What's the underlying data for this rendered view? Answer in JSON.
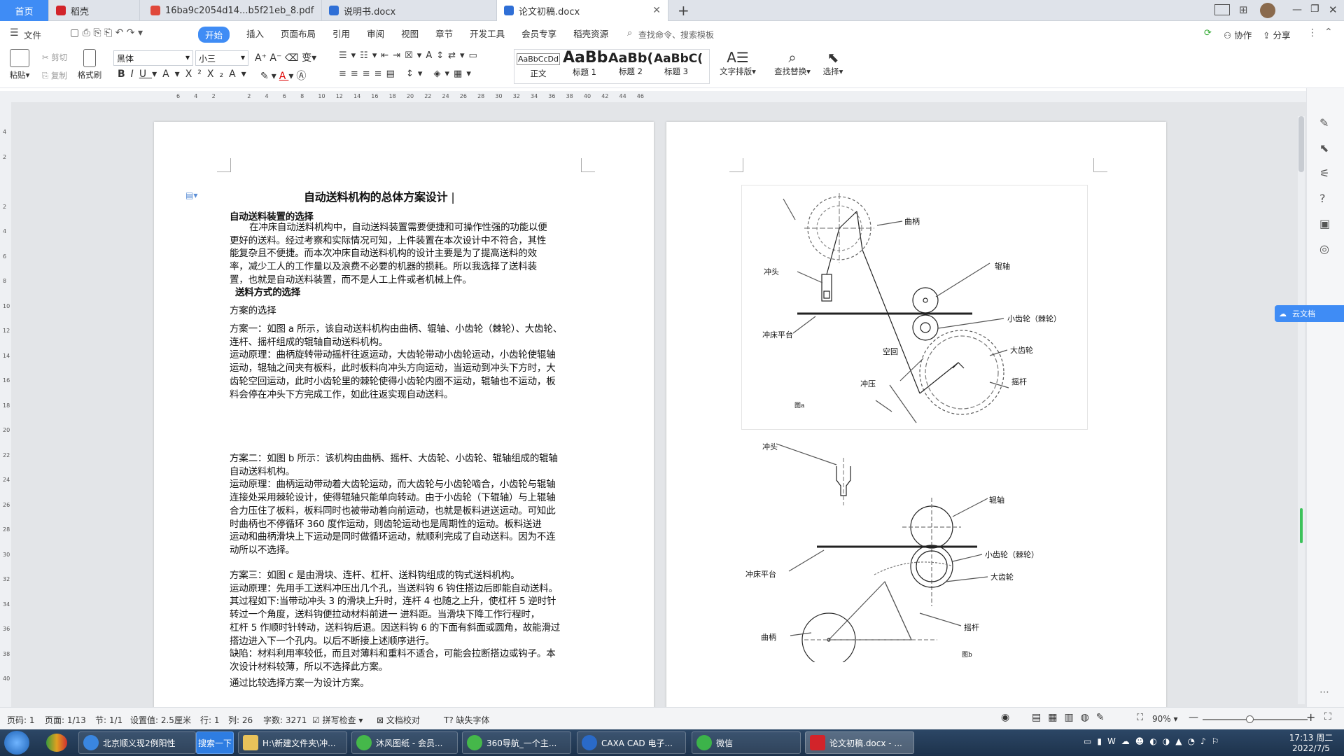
{
  "tabs": [
    {
      "label": "首页",
      "active": false
    },
    {
      "label": "稻壳",
      "active": false
    },
    {
      "label": "16ba9c2054d14...b5f21eb_8.pdf",
      "active": false
    },
    {
      "label": "说明书.docx",
      "active": false
    },
    {
      "label": "论文初稿.docx",
      "active": true
    }
  ],
  "menubar": {
    "file": "文件",
    "items": [
      "开始",
      "插入",
      "页面布局",
      "引用",
      "审阅",
      "视图",
      "章节",
      "开发工具",
      "会员专享",
      "稻壳资源"
    ],
    "active": "开始",
    "search": "查找命令、搜索模板",
    "collab": "协作",
    "share": "分享"
  },
  "ribbon": {
    "paste": "粘贴",
    "cut": "剪切",
    "copy": "复制",
    "format_painter": "格式刷",
    "font_name": "黑体",
    "font_size": "小三",
    "styles": [
      {
        "preview": "AaBbCcDd",
        "name": "正文"
      },
      {
        "preview": "AaBb",
        "name": "标题 1"
      },
      {
        "preview": "AaBb(",
        "name": "标题 2"
      },
      {
        "preview": "AaBbC(",
        "name": "标题 3"
      }
    ],
    "text_layout": "文字排版",
    "find_replace": "查找替换",
    "select": "选择"
  },
  "ruler": {
    "h_ticks": [
      "6",
      "4",
      "2",
      "",
      "2",
      "4",
      "6",
      "8",
      "10",
      "12",
      "14",
      "16",
      "18",
      "20",
      "22",
      "24",
      "26",
      "28",
      "30",
      "32",
      "34",
      "36",
      "38",
      "40",
      "42",
      "44",
      "46"
    ],
    "v_ticks": [
      "4",
      "2",
      "",
      "2",
      "4",
      "6",
      "8",
      "10",
      "12",
      "14",
      "16",
      "18",
      "20",
      "22",
      "24",
      "26",
      "28",
      "30",
      "32",
      "34",
      "36",
      "38",
      "40"
    ]
  },
  "document": {
    "title": "自动送料机构的总体方案设计",
    "h1": "自动送料装置的选择",
    "para1": [
      "在冲床自动送料机构中，自动送料装置需要便捷和可操作性强的功能以便",
      "更好的送料。经过考察和实际情况可知，上件装置在本次设计中不符合，其性",
      "能复杂且不便捷。而本次冲床自动送料机构的设计主要是为了提高送料的效",
      "率，减少工人的工作量以及浪费不必要的机器的损耗。所以我选择了送料装",
      "置，也就是自动送料装置，而不是人工上件或者机械上件。"
    ],
    "h2": "送料方式的选择",
    "h3": "方案的选择",
    "scheme1": [
      "方案一：如图 a 所示，该自动送料机构由曲柄、辊轴、小齿轮（棘轮）、大齿轮、",
      "连杆、摇杆组成的辊轴自动送料机构。",
      "运动原理：曲柄旋转带动摇杆往返运动，大齿轮带动小齿轮运动，小齿轮使辊轴",
      "运动，辊轴之间夹有板料，此时板料向冲头方向运动，当运动到冲头下方时，大",
      "齿轮空回运动，此时小齿轮里的棘轮使得小齿轮内圈不运动，辊轴也不运动，板",
      "料会停在冲头下方完成工作，如此往返实现自动送料。"
    ],
    "scheme2": [
      "方案二：如图 b 所示：该机构由曲柄、摇杆、大齿轮、小齿轮、辊轴组成的辊轴",
      "自动送料机构。",
      "运动原理：曲柄运动带动着大齿轮运动，而大齿轮与小齿轮啮合，小齿轮与辊轴",
      "连接处采用棘轮设计，使得辊轴只能单向转动。由于小齿轮（下辊轴）与上辊轴",
      "合力压住了板料，板料同时也被带动着向前运动，也就是板料进送运动。可知此",
      "时曲柄也不停循环    360    度作运动，则齿轮运动也是周期性的运动。板料送进",
      "运动和曲柄滑块上下运动是同时做循环运动，就顺利完成了自动送料。因为不连",
      "动所以不选择。"
    ],
    "scheme3": [
      "方案三：如图 c 是由滑块、连杆、杠杆、送料钩组成的钩式送料机构。",
      "运动原理：先用手工送料冲压出几个孔，当送料钩 6 钩住搭边后即能自动送料。",
      "其过程如下:当带动冲头 3 的滑块上升时，连杆 4 也随之上升，使杠杆 5 逆时针",
      "转过一个角度，送料钩便拉动材料前进一    进料距。当滑块下降工作行程时，",
      "杠杆 5 作顺时针转动，送料钩后退。因送料钩 6 的下面有斜面或圆角，故能滑过",
      "搭边进入下一个孔内。以后不断接上述顺序进行。",
      "缺陷：材料利用率较低，而且对薄料和重料不适合，可能会拉断搭边或钩子。本",
      "次设计材料较薄，所以不选择此方案。"
    ],
    "conclusion": "通过比较选择方案一为设计方案。"
  },
  "figure_a": {
    "labels": [
      "曲柄",
      "冲头",
      "辊轴",
      "小齿轮（棘轮）",
      "冲床平台",
      "大齿轮",
      "空回",
      "冲压",
      "摇杆"
    ],
    "caption": "图a"
  },
  "figure_b": {
    "labels": [
      "冲头",
      "辊轴",
      "小齿轮（棘轮）",
      "冲床平台",
      "大齿轮",
      "摇杆",
      "曲柄"
    ],
    "caption": "图b"
  },
  "statusbar": {
    "page_no": "页码: 1",
    "page": "页面: 1/13",
    "section": "节: 1/1",
    "setting": "设置值: 2.5厘米",
    "row": "行: 1",
    "col": "列: 26",
    "words": "字数: 3271",
    "spell": "拼写检查",
    "proof": "文档校对",
    "missing_font": "缺失字体",
    "zoom": "90%"
  },
  "taskbar": {
    "items": [
      "北京顺义现2例阳性",
      "搜索一下",
      "H:\\新建文件夹\\冲...",
      "沐风图纸 - 会员...",
      "360导航_一个主...",
      "CAXA CAD 电子...",
      "微信",
      "论文初稿.docx - ..."
    ],
    "time": "17:13 周二",
    "date": "2022/7/5"
  },
  "cloud_button": "云文档",
  "colors": {
    "accent": "#3f8cf5",
    "taskbar": "#2c4766",
    "wps_red": "#d2242a"
  }
}
